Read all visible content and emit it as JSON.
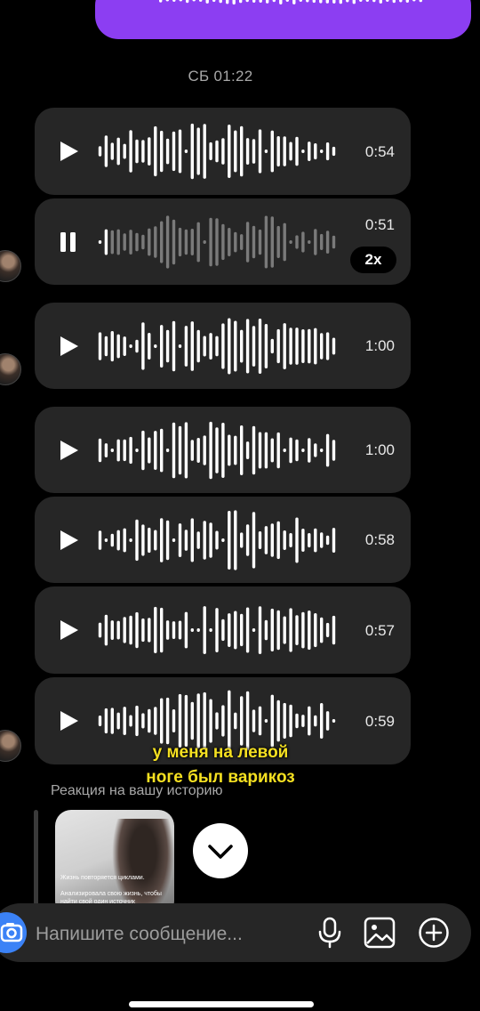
{
  "thread": {
    "timestamp": "СБ 01:22"
  },
  "voice_messages": [
    {
      "duration": "0:54",
      "state": "paused"
    },
    {
      "duration": "0:51",
      "state": "playing",
      "speed": "2x",
      "progress": 0.04
    },
    {
      "duration": "1:00",
      "state": "paused"
    },
    {
      "duration": "1:00",
      "state": "paused"
    },
    {
      "duration": "0:58",
      "state": "paused"
    },
    {
      "duration": "0:57",
      "state": "paused"
    },
    {
      "duration": "0:59",
      "state": "paused"
    }
  ],
  "caption": {
    "line1": "у меня на левой",
    "line2": "ноге был варикоз"
  },
  "story_reaction": {
    "label": "Реакция на вашу историю",
    "thumb_line1": "Жизнь повторяется циклами.",
    "thumb_line2": "Анализировала свою жизнь, чтобы",
    "thumb_line3": "найти свой один источник"
  },
  "composer": {
    "placeholder": "Напишите сообщение..."
  },
  "icons": {
    "play": "play-icon",
    "pause": "pause-icon",
    "scroll_down": "chevron-down-icon",
    "camera": "camera-icon",
    "microphone": "microphone-icon",
    "gallery": "image-icon",
    "add": "plus-circle-icon"
  },
  "colors": {
    "sent_bubble": "#8c3ef2",
    "received_bubble": "#262626",
    "caption": "#f5e021",
    "camera_button": "#3b82f6"
  }
}
